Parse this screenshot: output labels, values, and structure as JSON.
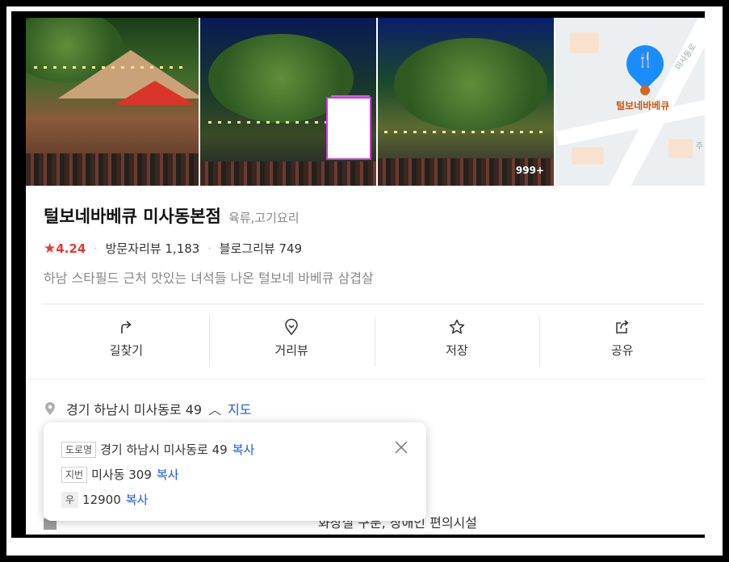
{
  "photos": {
    "more_count": "999+",
    "map_label": "털보네바베큐",
    "map_road_label": "미사동로",
    "map_side_label": "주"
  },
  "place": {
    "name": "털보네바베큐 미사동본점",
    "category": "육류,고기요리",
    "rating": "4.24",
    "visitor_reviews": "방문자리뷰 1,183",
    "blog_reviews": "블로그리뷰 749",
    "description": "하남 스타필드 근처 맛있는 녀석들 나온 털보네 바베큐 삼겹살"
  },
  "actions": [
    {
      "label": "길찾기",
      "icon": "directions-icon"
    },
    {
      "label": "거리뷰",
      "icon": "street-view-icon"
    },
    {
      "label": "저장",
      "icon": "star-icon"
    },
    {
      "label": "공유",
      "icon": "share-icon"
    }
  ],
  "address": {
    "text": "경기 하남시 미사동로 49",
    "map_link": "지도"
  },
  "popup": {
    "road_tag": "도로명",
    "road_address": "경기 하남시 미사동로 49",
    "lot_tag": "지번",
    "lot_address": "미사동 309",
    "zip_tag": "우",
    "zip_code": "12900",
    "copy_label": "복사"
  },
  "facilities_partial": "화장실 구분, 장애인 편의시설",
  "colors": {
    "accent_blue": "#1a5bd8",
    "rating_red": "#e53935",
    "map_pin": "#1a8cff"
  }
}
